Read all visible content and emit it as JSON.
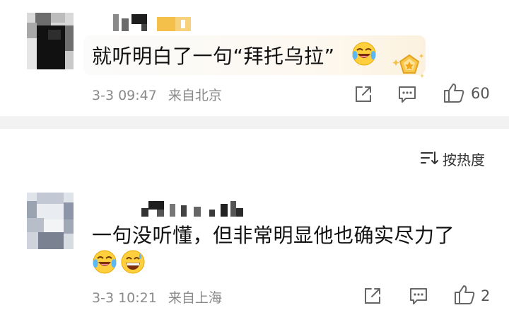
{
  "comments": [
    {
      "text": "就听明白了一句“拜托乌拉”",
      "date": "3-3 09:47",
      "location": "来自北京",
      "likes": "60",
      "emojis": [
        "laugh-cry-emoji"
      ],
      "badge": "gold-badge-icon"
    },
    {
      "text": "一句没听懂，但非常明显他也确实尽力了",
      "date": "3-3 10:21",
      "location": "来自上海",
      "likes": "2",
      "emojis": [
        "laugh-cry-emoji",
        "grin-sweat-emoji"
      ]
    }
  ],
  "sort": {
    "label": "按热度",
    "icon": "sort-icon"
  },
  "colors": {
    "icon_gray": "#666666",
    "gold": "#f5c04a",
    "divider": "#f2f2f2"
  }
}
